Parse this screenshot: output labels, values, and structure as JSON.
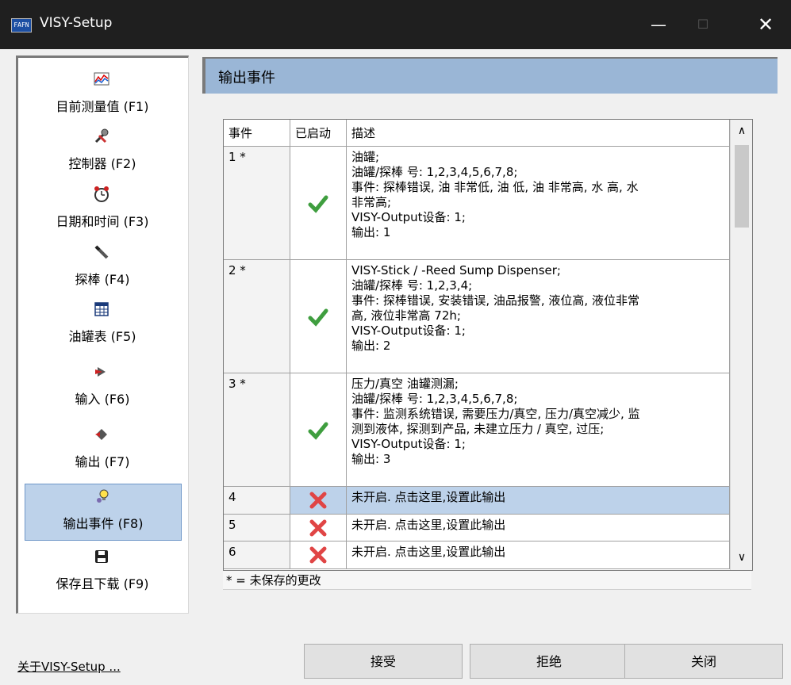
{
  "window": {
    "title": "VISY-Setup",
    "icon_label": "FAFN"
  },
  "sidebar": {
    "items": [
      {
        "label": "目前测量值 (F1)",
        "icon": "chart-icon"
      },
      {
        "label": "控制器 (F2)",
        "icon": "tools-icon"
      },
      {
        "label": "日期和时间 (F3)",
        "icon": "clock-icon"
      },
      {
        "label": "探棒 (F4)",
        "icon": "probe-icon"
      },
      {
        "label": "油罐表 (F5)",
        "icon": "table-icon"
      },
      {
        "label": "输入 (F6)",
        "icon": "input-icon"
      },
      {
        "label": "输出 (F7)",
        "icon": "output-icon"
      },
      {
        "label": "输出事件 (F8)",
        "icon": "lightbulb-icon",
        "active": true
      },
      {
        "label": "保存且下载 (F9)",
        "icon": "save-icon"
      }
    ],
    "about_link": "关于VISY-Setup ..."
  },
  "header": {
    "title": "输出事件"
  },
  "grid": {
    "columns": [
      "事件",
      "已启动",
      "描述"
    ],
    "rows": [
      {
        "event": "1 *",
        "enabled": true,
        "description": "油罐;\n油罐/探棒 号: 1,2,3,4,5,6,7,8;\n事件: 探棒错误, 油 非常低, 油 低, 油 非常高, 水 高, 水\n非常高;\nVISY-Output设备: 1;\n输出: 1"
      },
      {
        "event": "2 *",
        "enabled": true,
        "description": "VISY-Stick / -Reed Sump Dispenser;\n油罐/探棒 号: 1,2,3,4;\n事件: 探棒错误, 安装错误, 油品报警, 液位高, 液位非常\n高, 液位非常高 72h;\nVISY-Output设备: 1;\n输出: 2"
      },
      {
        "event": "3 *",
        "enabled": true,
        "description": "压力/真空 油罐测漏;\n油罐/探棒 号: 1,2,3,4,5,6,7,8;\n事件: 监测系统错误, 需要压力/真空, 压力/真空减少, 监\n测到液体, 探测到产品, 未建立压力 / 真空, 过压;\nVISY-Output设备: 1;\n输出: 3"
      },
      {
        "event": "4",
        "enabled": false,
        "description": "未开启. 点击这里,设置此输出",
        "selected": true
      },
      {
        "event": "5",
        "enabled": false,
        "description": "未开启. 点击这里,设置此输出"
      },
      {
        "event": "6",
        "enabled": false,
        "description": "未开启. 点击这里,设置此输出"
      }
    ],
    "footnote": "* = 未保存的更改"
  },
  "buttons": {
    "accept": "接受",
    "reject": "拒绝",
    "close": "关闭"
  }
}
